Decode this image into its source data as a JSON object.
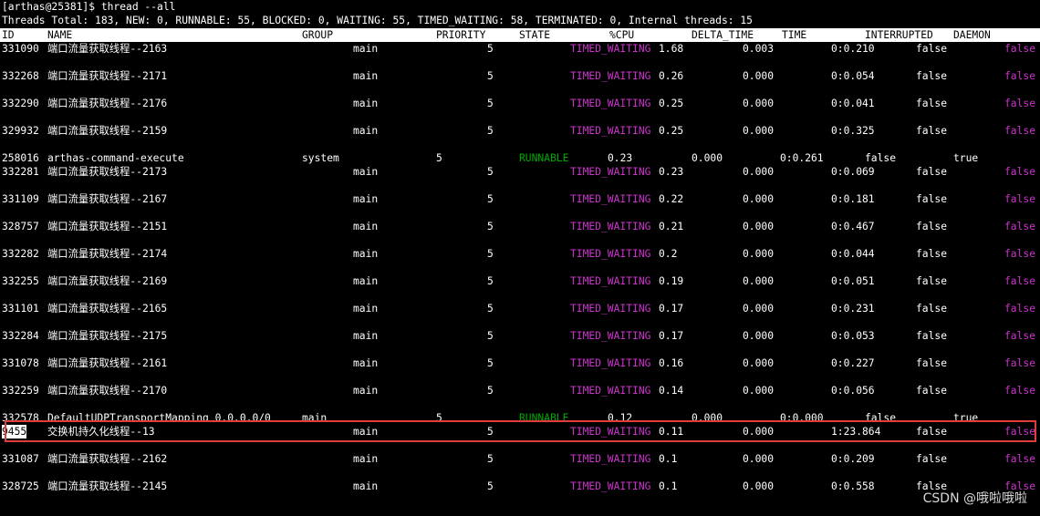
{
  "terminal": {
    "prompt": "[arthas@25381]$ thread --all",
    "summary": "Threads Total: 183, NEW: 0, RUNNABLE: 55, BLOCKED: 0, WAITING: 55, TIMED_WAITING: 58, TERMINATED: 0, Internal threads: 15"
  },
  "table": {
    "headers": {
      "id": "ID",
      "name": "NAME",
      "group": "GROUP",
      "priority": "PRIORITY",
      "state": "STATE",
      "cpu": "%CPU",
      "delta_time": "DELTA_TIME",
      "time": "TIME",
      "interrupted": "INTERRUPTED",
      "daemon": "DAEMON"
    },
    "rows": [
      {
        "id": "331090",
        "name": "端口流量获取线程--2163",
        "group": "main",
        "priority": "5",
        "state": "TIMED_WAITING",
        "cpu": "1.68",
        "delta_time": "0.003",
        "time": "0:0.210",
        "interrupted": "false",
        "daemon": "false"
      },
      {
        "id": "332268",
        "name": "端口流量获取线程--2171",
        "group": "main",
        "priority": "5",
        "state": "TIMED_WAITING",
        "cpu": "0.26",
        "delta_time": "0.000",
        "time": "0:0.054",
        "interrupted": "false",
        "daemon": "false"
      },
      {
        "id": "332290",
        "name": "端口流量获取线程--2176",
        "group": "main",
        "priority": "5",
        "state": "TIMED_WAITING",
        "cpu": "0.25",
        "delta_time": "0.000",
        "time": "0:0.041",
        "interrupted": "false",
        "daemon": "false"
      },
      {
        "id": "329932",
        "name": "端口流量获取线程--2159",
        "group": "main",
        "priority": "5",
        "state": "TIMED_WAITING",
        "cpu": "0.25",
        "delta_time": "0.000",
        "time": "0:0.325",
        "interrupted": "false",
        "daemon": "false"
      },
      {
        "id": "258016",
        "name": "arthas-command-execute",
        "group": "system",
        "priority": "5",
        "state": "RUNNABLE",
        "cpu": "0.23",
        "delta_time": "0.000",
        "time": "0:0.261",
        "interrupted": "false",
        "daemon": "true"
      },
      {
        "id": "332281",
        "name": "端口流量获取线程--2173",
        "group": "main",
        "priority": "5",
        "state": "TIMED_WAITING",
        "cpu": "0.23",
        "delta_time": "0.000",
        "time": "0:0.069",
        "interrupted": "false",
        "daemon": "false"
      },
      {
        "id": "331109",
        "name": "端口流量获取线程--2167",
        "group": "main",
        "priority": "5",
        "state": "TIMED_WAITING",
        "cpu": "0.22",
        "delta_time": "0.000",
        "time": "0:0.181",
        "interrupted": "false",
        "daemon": "false"
      },
      {
        "id": "328757",
        "name": "端口流量获取线程--2151",
        "group": "main",
        "priority": "5",
        "state": "TIMED_WAITING",
        "cpu": "0.21",
        "delta_time": "0.000",
        "time": "0:0.467",
        "interrupted": "false",
        "daemon": "false"
      },
      {
        "id": "332282",
        "name": "端口流量获取线程--2174",
        "group": "main",
        "priority": "5",
        "state": "TIMED_WAITING",
        "cpu": "0.2",
        "delta_time": "0.000",
        "time": "0:0.044",
        "interrupted": "false",
        "daemon": "false"
      },
      {
        "id": "332255",
        "name": "端口流量获取线程--2169",
        "group": "main",
        "priority": "5",
        "state": "TIMED_WAITING",
        "cpu": "0.19",
        "delta_time": "0.000",
        "time": "0:0.051",
        "interrupted": "false",
        "daemon": "false"
      },
      {
        "id": "331101",
        "name": "端口流量获取线程--2165",
        "group": "main",
        "priority": "5",
        "state": "TIMED_WAITING",
        "cpu": "0.17",
        "delta_time": "0.000",
        "time": "0:0.231",
        "interrupted": "false",
        "daemon": "false"
      },
      {
        "id": "332284",
        "name": "端口流量获取线程--2175",
        "group": "main",
        "priority": "5",
        "state": "TIMED_WAITING",
        "cpu": "0.17",
        "delta_time": "0.000",
        "time": "0:0.053",
        "interrupted": "false",
        "daemon": "false"
      },
      {
        "id": "331078",
        "name": "端口流量获取线程--2161",
        "group": "main",
        "priority": "5",
        "state": "TIMED_WAITING",
        "cpu": "0.16",
        "delta_time": "0.000",
        "time": "0:0.227",
        "interrupted": "false",
        "daemon": "false"
      },
      {
        "id": "332259",
        "name": "端口流量获取线程--2170",
        "group": "main",
        "priority": "5",
        "state": "TIMED_WAITING",
        "cpu": "0.14",
        "delta_time": "0.000",
        "time": "0:0.056",
        "interrupted": "false",
        "daemon": "false"
      },
      {
        "id": "332578",
        "name": "DefaultUDPTransportMapping_0.0.0.0/0",
        "group": "main",
        "priority": "5",
        "state": "RUNNABLE",
        "cpu": "0.12",
        "delta_time": "0.000",
        "time": "0:0.000",
        "interrupted": "false",
        "daemon": "true"
      },
      {
        "id": "9455",
        "name": "交换机持久化线程--13",
        "group": "main",
        "priority": "5",
        "state": "TIMED_WAITING",
        "cpu": "0.11",
        "delta_time": "0.000",
        "time": "1:23.864",
        "interrupted": "false",
        "daemon": "false"
      },
      {
        "id": "331087",
        "name": "端口流量获取线程--2162",
        "group": "main",
        "priority": "5",
        "state": "TIMED_WAITING",
        "cpu": "0.1",
        "delta_time": "0.000",
        "time": "0:0.209",
        "interrupted": "false",
        "daemon": "false"
      },
      {
        "id": "328725",
        "name": "端口流量获取线程--2145",
        "group": "main",
        "priority": "5",
        "state": "TIMED_WAITING",
        "cpu": "0.1",
        "delta_time": "0.000",
        "time": "0:0.558",
        "interrupted": "false",
        "daemon": "false"
      }
    ]
  },
  "colors": {
    "timed_waiting": "#cc33cc",
    "runnable": "#00aa00",
    "highlight_border": "#e03c3c"
  },
  "watermark": "CSDN @哦啦哦啦"
}
